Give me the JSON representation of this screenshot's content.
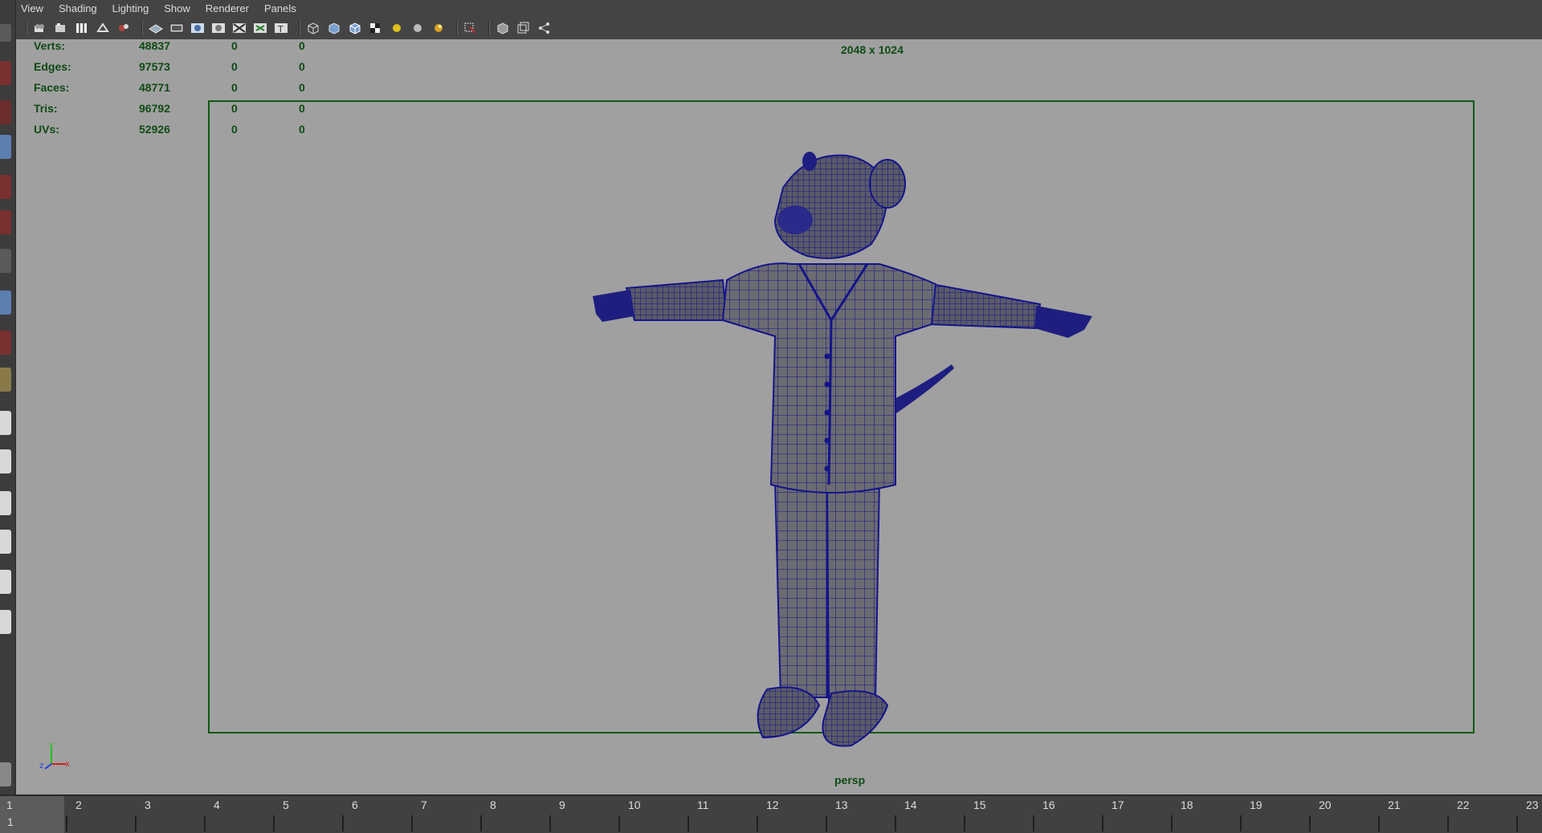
{
  "menu": [
    "View",
    "Shading",
    "Lighting",
    "Show",
    "Renderer",
    "Panels"
  ],
  "toolbar_icons": [
    "camera-select-icon",
    "camera-attributes-icon",
    "bookmarks-icon",
    "image-plane-icon",
    "camera-tools-icon",
    "sep",
    "grid-icon",
    "film-gate-icon",
    "resolution-gate-icon",
    "gate-mask-icon",
    "field-chart-icon",
    "safe-title-icon",
    "sep",
    "wireframe-icon",
    "smooth-shade-icon",
    "wireframe-on-shaded-icon",
    "textured-icon",
    "default-light-icon",
    "all-lights-icon",
    "shadows-icon",
    "sep",
    "isolate-select-icon",
    "sep",
    "xray-icon",
    "xray-joints-icon",
    "xray-components-icon"
  ],
  "hud": {
    "rows": [
      {
        "label": "Verts:",
        "value": "48837",
        "c1": "0",
        "c2": "0"
      },
      {
        "label": "Edges:",
        "value": "97573",
        "c1": "0",
        "c2": "0"
      },
      {
        "label": "Faces:",
        "value": "48771",
        "c1": "0",
        "c2": "0"
      },
      {
        "label": "Tris:",
        "value": "96792",
        "c1": "0",
        "c2": "0"
      },
      {
        "label": "UVs:",
        "value": "52926",
        "c1": "0",
        "c2": "0"
      }
    ],
    "resolution": "2048 x 1024",
    "camera": "persp"
  },
  "axis": {
    "x": "x",
    "y": "y",
    "z": "z"
  },
  "timeline": {
    "frames": [
      "1",
      "2",
      "3",
      "4",
      "5",
      "6",
      "7",
      "8",
      "9",
      "10",
      "11",
      "12",
      "13",
      "14",
      "15",
      "16",
      "17",
      "18",
      "19",
      "20",
      "21",
      "22",
      "23"
    ],
    "current_frame": "1"
  },
  "colors": {
    "wire": "#14148a",
    "hud": "#0f4a15",
    "gate": "#0c5a14"
  }
}
